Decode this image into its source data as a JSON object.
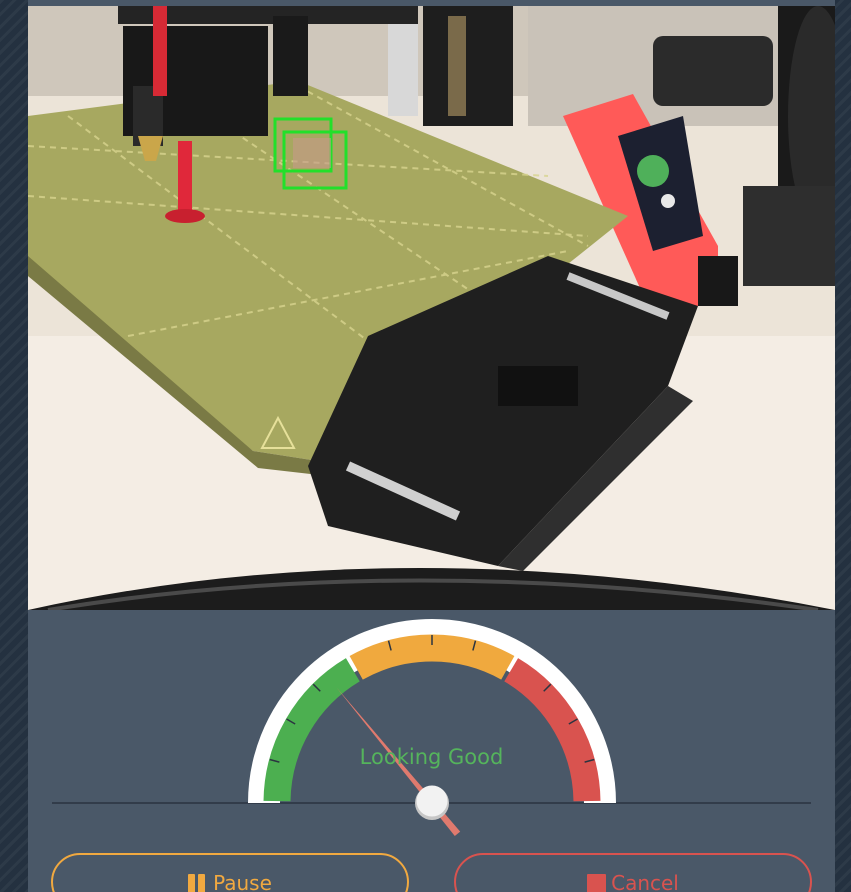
{
  "camera": {
    "icon": "webcam-feed-image",
    "detection_box_color": "#22e02a"
  },
  "gauge": {
    "status_label": "Looking Good",
    "level": 0.28,
    "zones": [
      {
        "name": "good",
        "color": "#4caf50"
      },
      {
        "name": "warning",
        "color": "#f0a93e"
      },
      {
        "name": "failing",
        "color": "#d9534f"
      }
    ],
    "needle_color": "#e07a6e"
  },
  "actions": {
    "pause_label": "Pause",
    "pause_icon": "pause-icon",
    "pause_color": "#f1a940",
    "cancel_label": "Cancel",
    "cancel_icon": "stop-icon",
    "cancel_color": "#d9534f"
  }
}
